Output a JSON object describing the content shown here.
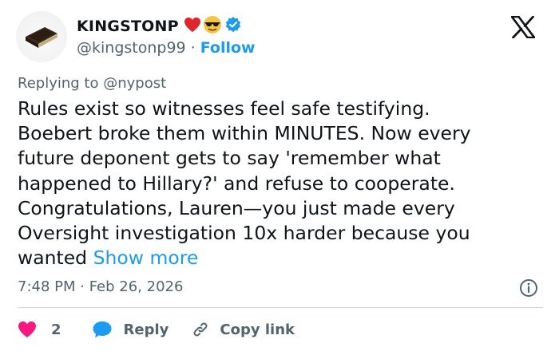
{
  "author": {
    "display_name": "KINGSTONP",
    "emojis": [
      "red-heart",
      "smiling-face-with-sunglasses"
    ],
    "verified": true,
    "handle": "@kingstonp99",
    "separator": "·",
    "follow_label": "Follow",
    "avatar_icon": "book-icon"
  },
  "reply_context": {
    "prefix": "Replying to ",
    "mention": "@nypost"
  },
  "tweet": {
    "lines": [
      "Rules exist so witnesses feel safe testifying.",
      "Boebert broke them within MINUTES. Now every",
      "future deponent gets to say 'remember what",
      "happened to Hillary?' and refuse to cooperate.",
      "Congratulations, Lauren—you just made every",
      "Oversight investigation 10x harder because you",
      "wanted "
    ],
    "show_more_label": "Show more"
  },
  "timestamp": "7:48 PM · Feb 26, 2026",
  "actions": {
    "like_count": "2",
    "reply_label": "Reply",
    "copy_label": "Copy link"
  },
  "colors": {
    "accent": "#1d9bf0",
    "like": "#f91880",
    "text": "#0f1419",
    "muted": "#536471",
    "divider": "#cfd9de"
  }
}
